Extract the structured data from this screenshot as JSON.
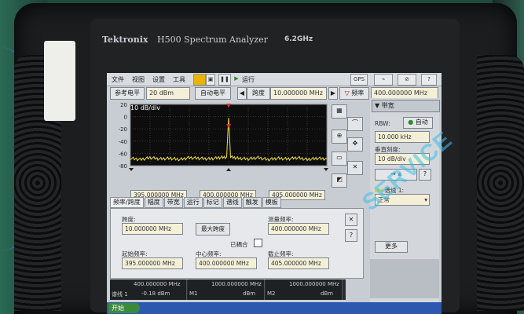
{
  "device": {
    "brand": "Tektronix",
    "model": "H500 Spectrum Analyzer",
    "max_freq": "6.2GHz"
  },
  "menu": {
    "file": "文件",
    "view": "视图",
    "setup": "设置",
    "tools": "工具",
    "run": "运行",
    "gps": "GPS",
    "help": "?"
  },
  "toolbar": {
    "ref_level_label": "参考电平",
    "ref_level_value": "20 dBm",
    "auto_level": "自动电平",
    "span_label": "跨度",
    "span_value": "10.000000 MHz",
    "freq_label": "频率",
    "freq_value": "400.000000 MHz"
  },
  "plot": {
    "scale_label": "10 dB/div",
    "y_ticks": [
      "20",
      "0",
      "-20",
      "-40",
      "-60",
      "-80"
    ],
    "start_freq": "395.000000 MHz",
    "center_freq": "400.000000 MHz",
    "stop_freq": "405.000000 MHz"
  },
  "chart_data": {
    "type": "line",
    "xlim": [
      395,
      405
    ],
    "ylim": [
      -80,
      20
    ],
    "series": [
      {
        "x": [
          395,
          395.5,
          396,
          396.5,
          397,
          397.5,
          398,
          398.5,
          399,
          399.5,
          399.9,
          400,
          400.1,
          400.5,
          401,
          401.5,
          402,
          402.5,
          403,
          403.5,
          404,
          404.5,
          405
        ],
        "values": [
          -68,
          -70,
          -67,
          -69,
          -68,
          -70,
          -67,
          -68,
          -69,
          -67,
          -66,
          -2,
          -66,
          -68,
          -69,
          -67,
          -70,
          -68,
          -69,
          -67,
          -70,
          -68,
          -69
        ]
      }
    ]
  },
  "tabs": [
    "频率/跨度",
    "幅度",
    "带宽",
    "运行",
    "标记",
    "谱线",
    "触发",
    "模板"
  ],
  "panel": {
    "span_label": "跨度:",
    "span_value": "10.000000 MHz",
    "max_span": "最大跨度",
    "linked": "已耦合",
    "start_label": "起始频率:",
    "start_value": "395.000000 MHz",
    "center_label": "中心频率:",
    "center_value": "400.000000 MHz",
    "measure_label": "测量频率:",
    "measure_value": "400.000000 MHz",
    "stop_label": "截止频率:",
    "stop_value": "405.000000 MHz",
    "close": "✕",
    "help": "?"
  },
  "right_panel": {
    "section": "▼ 带宽",
    "rbw_label": "RBW:",
    "auto": "自动",
    "rbw_value": "10.000 kHz",
    "vscale_label": "垂直刻度:",
    "vscale_value": "10 dB/div",
    "trace_label": "谱线 1:",
    "trace_value": "正常",
    "more": "更多",
    "help": "?"
  },
  "markers": [
    {
      "freq": "400.000000 MHz",
      "level": "-0.18 dBm",
      "name": "谱线 1"
    },
    {
      "freq": "1000.000000 MHz",
      "level": "dBm",
      "name": "M1"
    },
    {
      "freq": "1000.000000 MHz",
      "level": "dBm",
      "name": "M2"
    }
  ],
  "taskbar": {
    "start": "开始"
  },
  "watermark": "SERVICE"
}
